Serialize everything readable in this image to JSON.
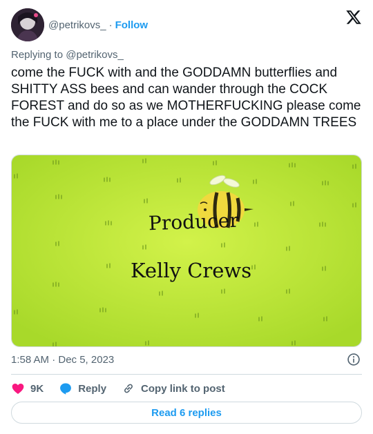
{
  "author": {
    "handle": "@petrikovs_",
    "follow_label": "Follow",
    "separator": "·"
  },
  "replying_to": "Replying to @petrikovs_",
  "tweet_text": "come the FUCK with and the GODDAMN butterflies and SHITTY ASS bees and can wander through the COCK FOREST and do so as we MOTHERFUCKING please come the FUCK with me to a place under the GODDAMN TREES",
  "media": {
    "line1": "Producer",
    "line2": "Kelly Crews",
    "bg_color": "#b8e62c"
  },
  "timestamp": "1:58 AM · Dec 5, 2023",
  "actions": {
    "likes": "9K",
    "reply_label": "Reply",
    "copy_label": "Copy link to post"
  },
  "read_replies_label": "Read 6 replies",
  "colors": {
    "accent": "#1d9bf0",
    "like": "#f91880",
    "muted": "#536471"
  }
}
